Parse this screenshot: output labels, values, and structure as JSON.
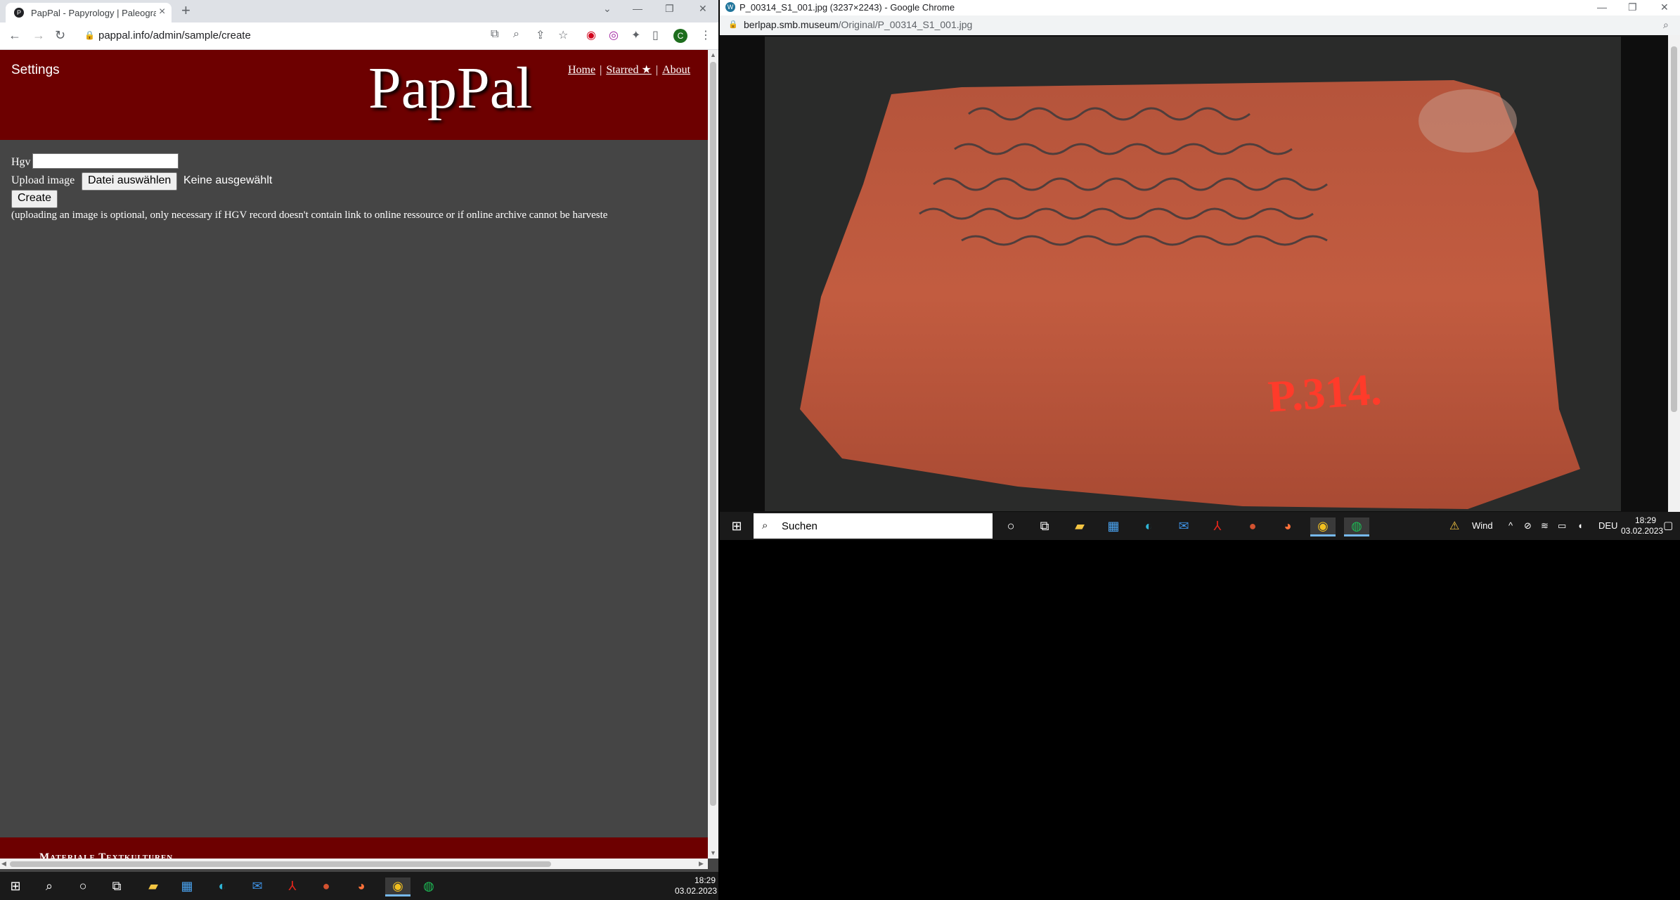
{
  "left_window": {
    "tab": {
      "favicon": "P",
      "title": "PapPal - Papyrology | Paleography"
    },
    "url": "pappal.info/admin/sample/create",
    "profile_initial": "C",
    "site": {
      "settings_label": "Settings",
      "logo": "PapPal",
      "nav": {
        "home": "Home",
        "starred": "Starred ★",
        "about": "About",
        "separator": "|"
      }
    },
    "form": {
      "hgv_label": "Hgv",
      "hgv_value": "",
      "upload_label": "Upload image",
      "file_button_label": "Datei auswählen",
      "file_status": "Keine ausgewählt",
      "create_label": "Create",
      "note": "(uploading an image is optional, only necessary if HGV record doesn't contain link to online ressource or if online archive cannot be harveste"
    },
    "footer_text": "Materiale Textkulturen"
  },
  "left_taskbar": {
    "time": "18:29",
    "date": "03.02.2023"
  },
  "right_window": {
    "title": "P_00314_S1_001.jpg (3237×2243) - Google Chrome",
    "url_host": "berlpap.smb.museum",
    "url_path": "/Original/P_00314_S1_001.jpg",
    "image_label": "P.314."
  },
  "right_taskbar": {
    "search_placeholder": "Suchen",
    "weather": "Wind",
    "language": "DEU",
    "time": "18:29",
    "date": "03.02.2023"
  },
  "icons": [
    "windows-icon",
    "search-icon",
    "cortana-icon",
    "taskview-icon",
    "explorer-icon",
    "store-icon",
    "edge-icon",
    "mail-icon",
    "acrobat-icon",
    "powerpoint-icon",
    "firefox-icon",
    "chrome-icon",
    "spotify-icon"
  ],
  "colors": {
    "header": "#6d0000",
    "page_bg": "#454545",
    "accent": "#76b9ed"
  }
}
